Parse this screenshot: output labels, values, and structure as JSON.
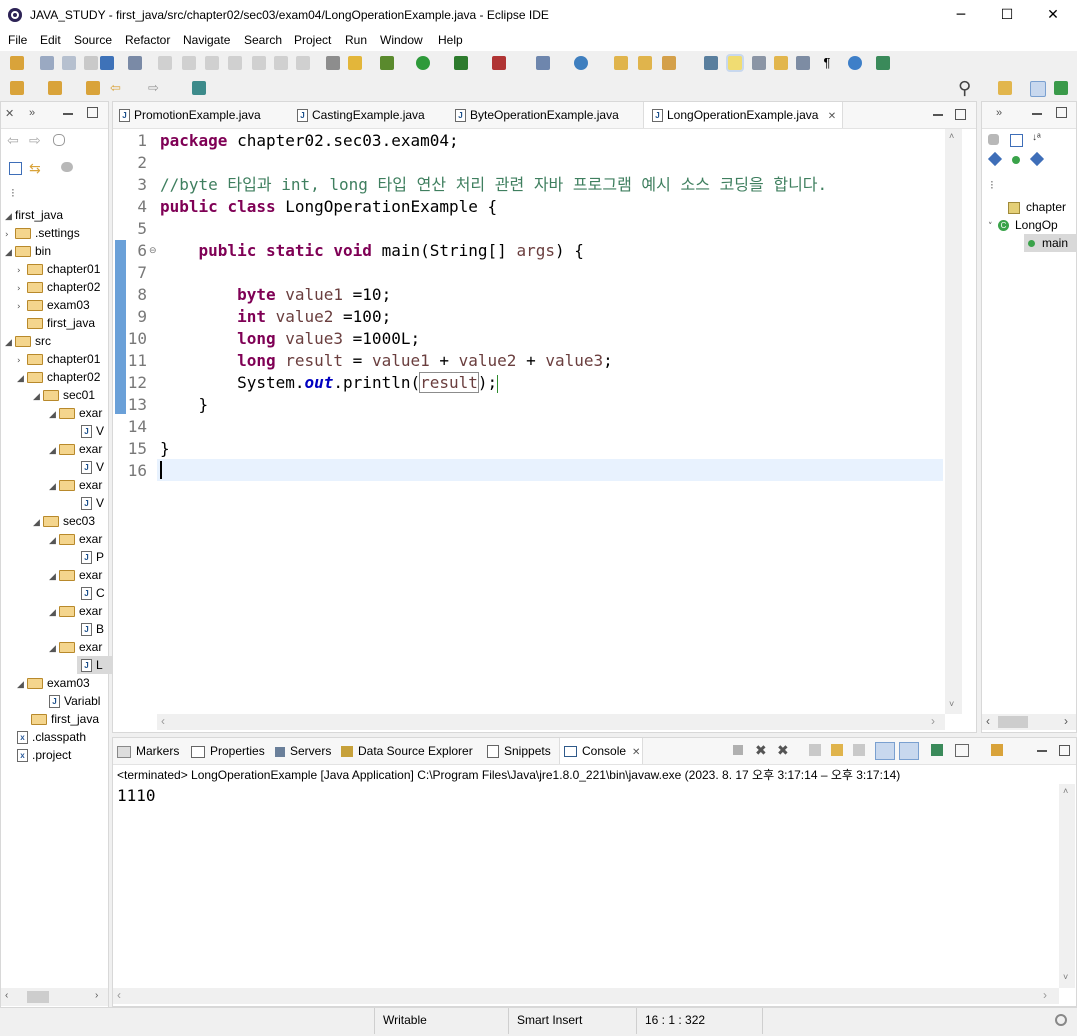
{
  "window": {
    "title": "JAVA_STUDY - first_java/src/chapter02/sec03/exam04/LongOperationExample.java - Eclipse IDE",
    "minimize": "─",
    "maximize": "☐",
    "close": "✕"
  },
  "menu": [
    "File",
    "Edit",
    "Source",
    "Refactor",
    "Navigate",
    "Search",
    "Project",
    "Run",
    "Window",
    "Help"
  ],
  "editor": {
    "tabs": [
      "PromotionExample.java",
      "CastingExample.java",
      "ByteOperationExample.java",
      "LongOperationExample.java"
    ],
    "active_tab_close": "✕",
    "line_numbers": [
      "1",
      "2",
      "3",
      "4",
      "5",
      "6",
      "7",
      "8",
      "9",
      "10",
      "11",
      "12",
      "13",
      "14",
      "15",
      "16"
    ],
    "code": {
      "l1_kw": "package",
      "l1_rest": " chapter02.sec03.exam04;",
      "l3": "//byte 타입과 int, long 타입 연산 처리 관련 자바 프로그램 예시 소스 코딩을 합니다.",
      "l4_kw1": "public",
      "l4_kw2": "class",
      "l4_rest": " LongOperationExample {",
      "l6_kw1": "public",
      "l6_kw2": "static",
      "l6_kw3": "void",
      "l6_rest1": " main(String[] ",
      "l6_var": "args",
      "l6_rest2": ") {",
      "l8_kw": "byte",
      "l8_var": "value1",
      "l8_rest": " =10;",
      "l9_kw": "int",
      "l9_var": "value2",
      "l9_rest": " =100;",
      "l10_kw": "long",
      "l10_var": "value3",
      "l10_rest": " =1000L;",
      "l11_kw": "long",
      "l11_var1": "result",
      "l11_eq": " = ",
      "l11_var2": "value1",
      "l11_plus1": " + ",
      "l11_var3": "value2",
      "l11_plus2": " + ",
      "l11_var4": "value3",
      "l11_end": ";",
      "l12_a": "System.",
      "l12_fld": "out",
      "l12_b": ".println(",
      "l12_var": "result",
      "l12_c": ");",
      "l13": "}",
      "l15": "}"
    }
  },
  "explorer": {
    "items": [
      {
        "label": "first_java",
        "type": "project"
      },
      {
        "label": ".settings",
        "type": "folder"
      },
      {
        "label": "bin",
        "type": "folder"
      },
      {
        "label": "chapter01",
        "type": "folder"
      },
      {
        "label": "chapter02",
        "type": "folder"
      },
      {
        "label": "exam03",
        "type": "folder"
      },
      {
        "label": "first_java",
        "type": "folder"
      },
      {
        "label": "src",
        "type": "folder"
      },
      {
        "label": "chapter01",
        "type": "folder"
      },
      {
        "label": "chapter02",
        "type": "folder"
      },
      {
        "label": "sec01",
        "type": "folder"
      },
      {
        "label": "exar",
        "type": "folder"
      },
      {
        "label": "V",
        "type": "java"
      },
      {
        "label": "exar",
        "type": "folder"
      },
      {
        "label": "V",
        "type": "java"
      },
      {
        "label": "exar",
        "type": "folder"
      },
      {
        "label": "V",
        "type": "java"
      },
      {
        "label": "sec03",
        "type": "folder"
      },
      {
        "label": "exar",
        "type": "folder"
      },
      {
        "label": "P",
        "type": "java"
      },
      {
        "label": "exar",
        "type": "folder"
      },
      {
        "label": "C",
        "type": "java"
      },
      {
        "label": "exar",
        "type": "folder"
      },
      {
        "label": "B",
        "type": "java"
      },
      {
        "label": "exar",
        "type": "folder"
      },
      {
        "label": "L",
        "type": "java"
      },
      {
        "label": "exam03",
        "type": "folder"
      },
      {
        "label": "Variabl",
        "type": "java"
      },
      {
        "label": "first_java",
        "type": "folder"
      },
      {
        "label": ".classpath",
        "type": "file"
      },
      {
        "label": ".project",
        "type": "file"
      }
    ]
  },
  "outline": {
    "items": [
      "chapter",
      "LongOp",
      "main"
    ]
  },
  "bottom": {
    "tabs": [
      "Markers",
      "Properties",
      "Servers",
      "Data Source Explorer",
      "Snippets",
      "Console"
    ],
    "console_header": "<terminated> LongOperationExample [Java Application] C:\\Program Files\\Java\\jre1.8.0_221\\bin\\javaw.exe  (2023. 8. 17 오후 3:17:14 – 오후 3:17:14)",
    "output": "1110"
  },
  "status": {
    "writable": "Writable",
    "insert_mode": "Smart Insert",
    "position": "16 : 1 : 322"
  },
  "colors": {
    "keyword": "#7f0055",
    "comment": "#3f7f5f",
    "variable": "#6a3e3e",
    "field": "#0000c0",
    "current_line": "#e8f2fe"
  }
}
